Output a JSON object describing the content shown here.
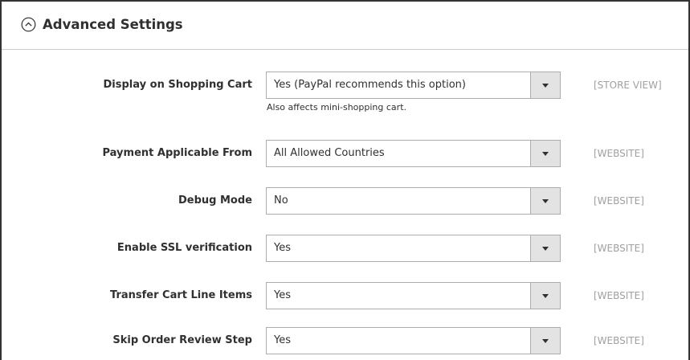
{
  "section": {
    "title": "Advanced Settings",
    "icon": "collapse-circle-icon"
  },
  "fields": [
    {
      "label": "Display on Shopping Cart",
      "value": "Yes (PayPal recommends this option)",
      "scope": "[STORE VIEW]",
      "note": "Also affects mini-shopping cart."
    },
    {
      "label": "Payment Applicable From",
      "value": "All Allowed Countries",
      "scope": "[WEBSITE]"
    },
    {
      "label": "Debug Mode",
      "value": "No",
      "scope": "[WEBSITE]"
    },
    {
      "label": "Enable SSL verification",
      "value": "Yes",
      "scope": "[WEBSITE]"
    },
    {
      "label": "Transfer Cart Line Items",
      "value": "Yes",
      "scope": "[WEBSITE]"
    },
    {
      "label": "Skip Order Review Step",
      "value": "Yes",
      "scope": "[WEBSITE]"
    }
  ],
  "colors": {
    "border": "#adadad",
    "button_bg": "#e3e3e3",
    "scope_text": "#a0a0a0",
    "text": "#303030"
  }
}
